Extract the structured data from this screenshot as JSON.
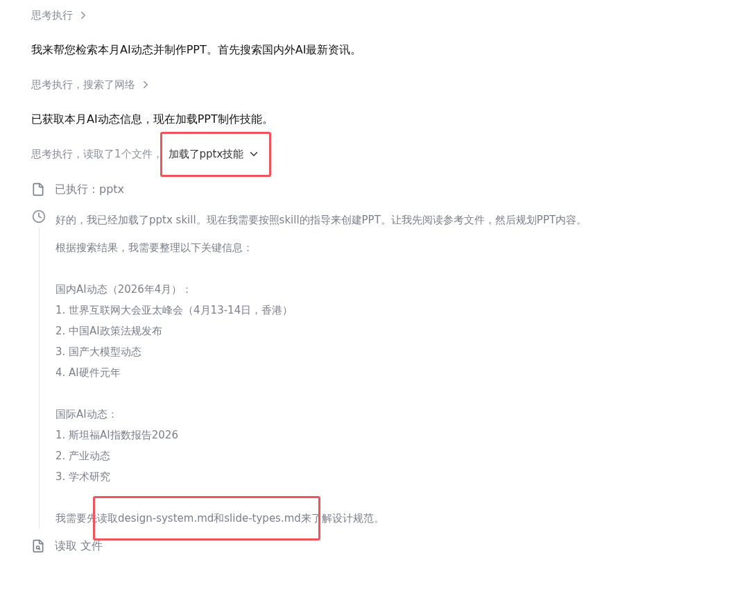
{
  "steps": [
    {
      "kind": "summary",
      "text": "思考执行",
      "expanded": false
    },
    {
      "kind": "message",
      "text": "我来帮您检索本月AI动态并制作PPT。首先搜索国内外AI最新资讯。"
    },
    {
      "kind": "summary",
      "text": "思考执行，搜索了网络",
      "expanded": false
    },
    {
      "kind": "message",
      "text": "已获取本月AI动态信息，现在加载PPT制作技能。"
    },
    {
      "kind": "summary",
      "text": "思考执行，读取了1个文件，",
      "toggle": {
        "label": "加载了pptx技能",
        "expanded": true,
        "highlighted": true
      }
    }
  ],
  "actions": [
    {
      "kind": "file",
      "text": "已执行：pptx"
    },
    {
      "kind": "thought",
      "paragraphs": [
        {
          "lines": [
            "好的，我已经加载了pptx skill。现在我需要按照skill的指导来创建PPT。让我先阅读参考文件，然后规划PPT内容。"
          ],
          "highlighted": false
        },
        {
          "lines": [
            "根据搜索结果，我需要整理以下关键信息："
          ],
          "highlighted": false
        },
        {
          "lines": [
            "国内AI动态（2026年4月）：",
            "1. 世界互联网大会亚太峰会（4月13-14日，香港）",
            "2. 中国AI政策法规发布",
            "3. 国产大模型动态",
            "4. AI硬件元年"
          ],
          "highlighted": false
        },
        {
          "lines": [
            "国际AI动态：",
            "1. 斯坦福AI指数报告2026",
            "2. 产业动态",
            "3. 学术研究"
          ],
          "highlighted": false
        },
        {
          "lines": [
            "我需要先读取design-system.md和slide-types.md来了解设计规范。"
          ],
          "highlighted": true
        }
      ]
    },
    {
      "kind": "read",
      "text": "读取 文件"
    }
  ]
}
